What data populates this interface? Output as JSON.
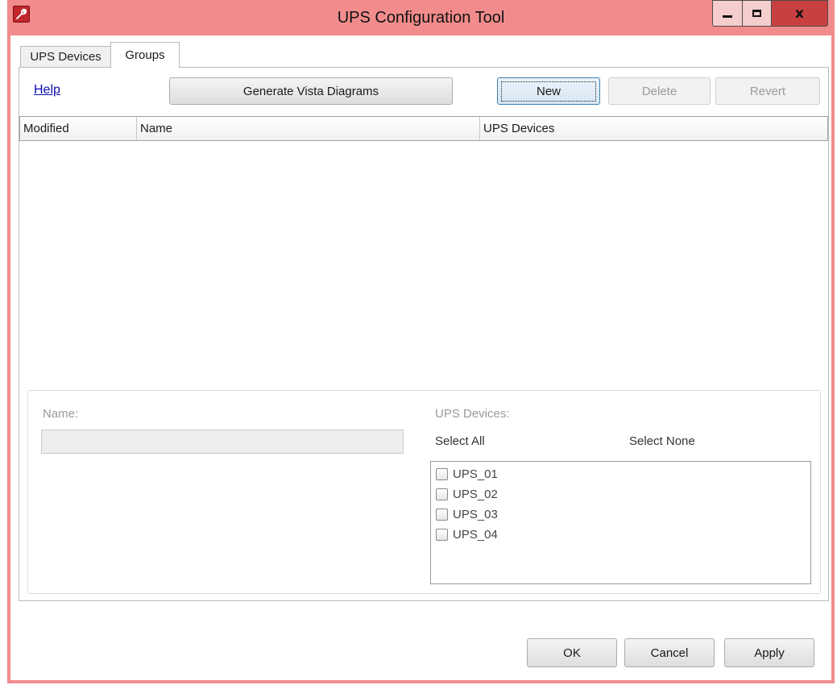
{
  "window": {
    "title": "UPS Configuration Tool",
    "icon": "wrench-app-icon",
    "controls": {
      "minimize": "minimize-icon",
      "maximize": "maximize-icon",
      "close_glyph": "x"
    }
  },
  "tabs": [
    {
      "label": "UPS Devices",
      "selected": false
    },
    {
      "label": "Groups",
      "selected": true
    }
  ],
  "toolbar": {
    "help_label": "Help",
    "generate_label": "Generate Vista Diagrams",
    "new_label": "New",
    "delete_label": "Delete",
    "revert_label": "Revert"
  },
  "table": {
    "columns": [
      "Modified",
      "Name",
      "UPS Devices"
    ],
    "rows": []
  },
  "details": {
    "name_label": "Name:",
    "name_value": "",
    "devices_label": "UPS Devices:",
    "select_all_label": "Select All",
    "select_none_label": "Select None",
    "devices": [
      {
        "label": "UPS_01",
        "checked": false
      },
      {
        "label": "UPS_02",
        "checked": false
      },
      {
        "label": "UPS_03",
        "checked": false
      },
      {
        "label": "UPS_04",
        "checked": false
      }
    ]
  },
  "footer": {
    "ok_label": "OK",
    "cancel_label": "Cancel",
    "apply_label": "Apply"
  },
  "colors": {
    "title_bar": "#f28c8c",
    "close_button": "#c94040",
    "link": "#0a0ab0",
    "disabled_text": "#9a9a9a"
  }
}
